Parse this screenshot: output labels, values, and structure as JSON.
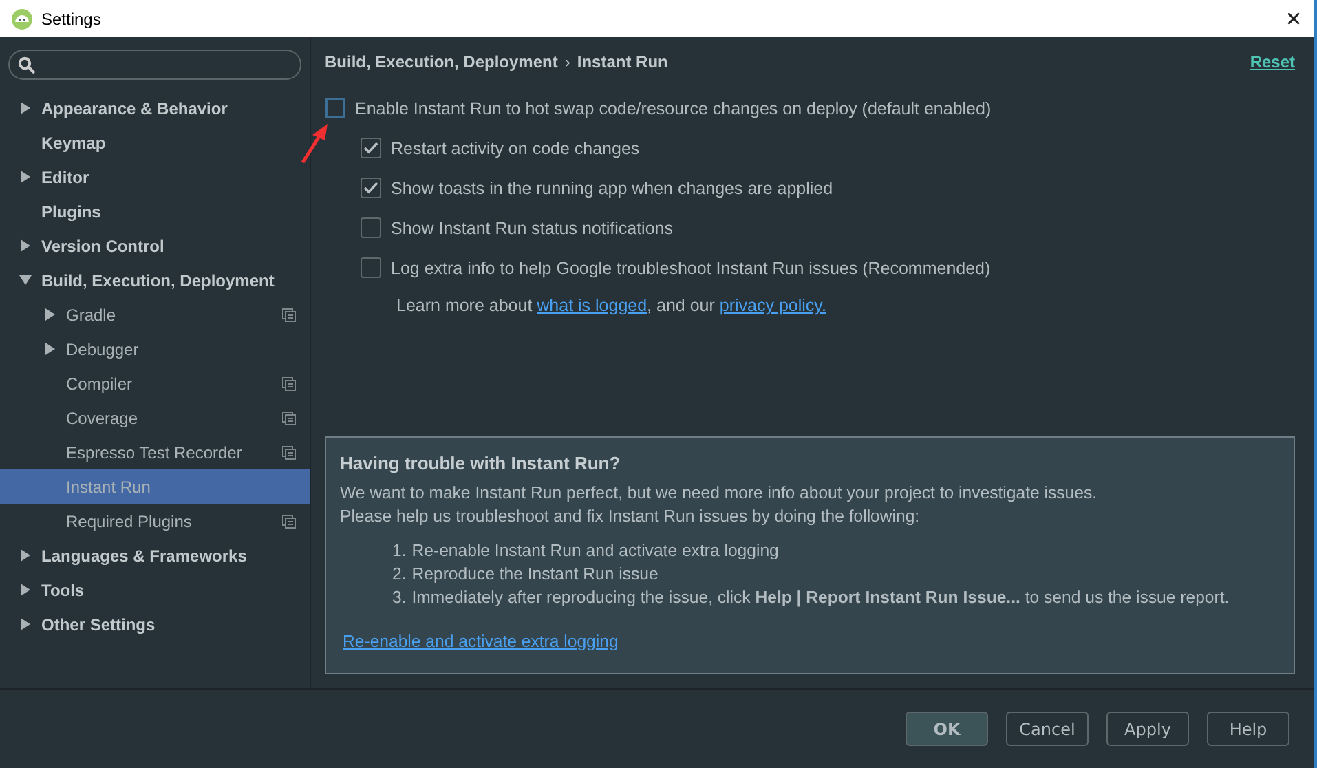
{
  "window": {
    "title": "Settings",
    "close": "✕"
  },
  "sidebar": {
    "items": [
      {
        "label": "Appearance & Behavior",
        "expanded": false,
        "selected": false
      },
      {
        "label": "Keymap",
        "selected": false
      },
      {
        "label": "Editor",
        "expanded": false,
        "selected": false
      },
      {
        "label": "Plugins",
        "selected": false
      },
      {
        "label": "Version Control",
        "expanded": false,
        "selected": false
      },
      {
        "label": "Build, Execution, Deployment",
        "expanded": true,
        "selected": false,
        "children": [
          {
            "label": "Gradle",
            "expanded": false,
            "selected": false,
            "project_level": true
          },
          {
            "label": "Debugger",
            "expanded": false,
            "selected": false,
            "project_level": false
          },
          {
            "label": "Compiler",
            "selected": false,
            "project_level": true
          },
          {
            "label": "Coverage",
            "selected": false,
            "project_level": true
          },
          {
            "label": "Espresso Test Recorder",
            "selected": false,
            "project_level": true
          },
          {
            "label": "Instant Run",
            "selected": true,
            "project_level": false
          },
          {
            "label": "Required Plugins",
            "selected": false,
            "project_level": true
          }
        ]
      },
      {
        "label": "Languages & Frameworks",
        "expanded": false,
        "selected": false
      },
      {
        "label": "Tools",
        "expanded": false,
        "selected": false
      },
      {
        "label": "Other Settings",
        "expanded": false,
        "selected": false
      }
    ]
  },
  "breadcrumb": {
    "parent": "Build, Execution, Deployment",
    "separator": "›",
    "current": "Instant Run"
  },
  "reset": "Reset",
  "options": [
    {
      "label": "Enable Instant Run to hot swap code/resource changes on deploy (default enabled)",
      "checked": false,
      "indented": false
    },
    {
      "label": "Restart activity on code changes",
      "checked": true,
      "indented": true
    },
    {
      "label": "Show toasts in the running app when changes are applied",
      "checked": true,
      "indented": true
    },
    {
      "label": "Show Instant Run status notifications",
      "checked": false,
      "indented": true
    },
    {
      "label": "Log extra info to help Google troubleshoot Instant Run issues (Recommended)",
      "checked": false,
      "indented": true
    }
  ],
  "learn_more": {
    "before": "Learn more about ",
    "link1": "what is logged",
    "middle": ", and our ",
    "link2": "privacy policy."
  },
  "trouble": {
    "title": "Having trouble with Instant Run?",
    "paragraph": [
      "We want to make Instant Run perfect, but we need more info about your project to investigate issues.",
      "Please help us troubleshoot and fix Instant Run issues by doing the following:"
    ],
    "steps": [
      {
        "number": "1.",
        "text": "Re-enable Instant Run and activate extra logging"
      },
      {
        "number": "2.",
        "text": "Reproduce the Instant Run issue"
      },
      {
        "number": "3.",
        "text": "Immediately after reproducing the issue, click **Help | Report Instant Run Issue...** to send us the issue report."
      }
    ],
    "link": "Re-enable and activate extra logging"
  },
  "buttons": [
    {
      "label": "OK",
      "default": true
    },
    {
      "label": "Cancel",
      "default": false
    },
    {
      "label": "Apply",
      "default": false
    },
    {
      "label": "Help",
      "default": false
    }
  ]
}
